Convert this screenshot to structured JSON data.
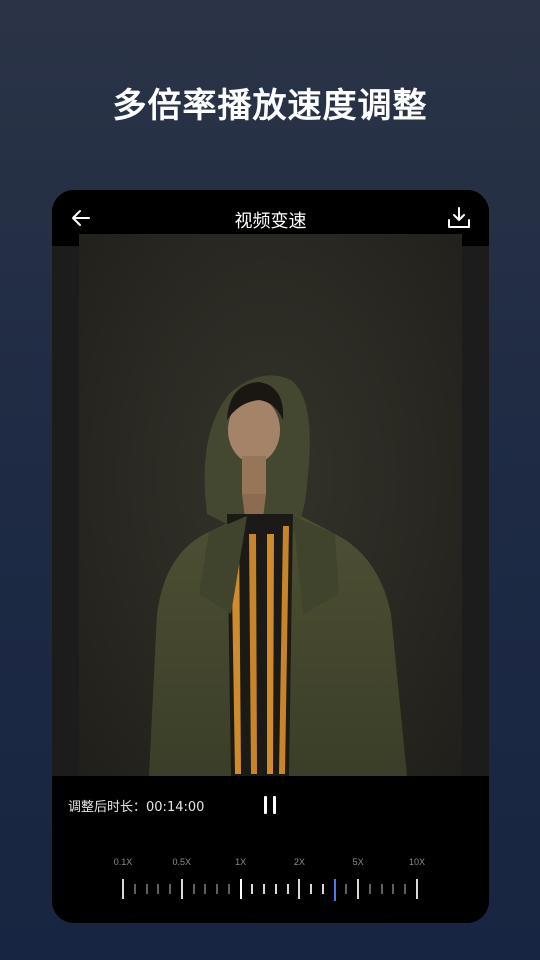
{
  "headline": "多倍率播放速度调整",
  "topbar": {
    "title": "视频变速",
    "back_icon": "arrow-left-icon",
    "download_icon": "download-icon"
  },
  "controls": {
    "duration_label": "调整后时长：",
    "duration_value": "00:14:00",
    "pause_icon": "pause-icon"
  },
  "speed_slider": {
    "labels": [
      "0.1X",
      "0.5X",
      "1X",
      "2X",
      "5X",
      "10X"
    ],
    "selected_index": 18,
    "tick_count": 26,
    "colors": {
      "active": "#4a7bf7",
      "major": "#d8d8d8",
      "highlight": "#ffffff",
      "minor": "#5f5f5f"
    }
  }
}
